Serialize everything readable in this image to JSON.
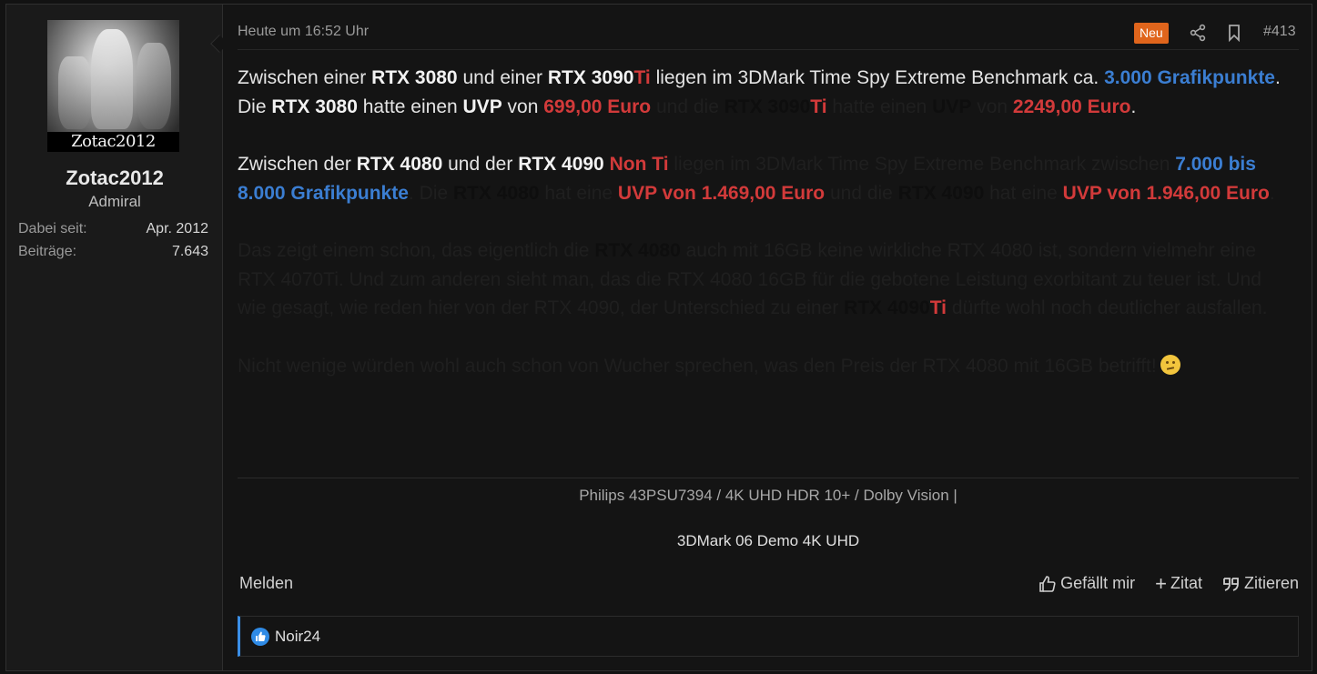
{
  "user": {
    "avatar_caption": "Zotac2012",
    "name": "Zotac2012",
    "title": "Admiral",
    "stats": [
      {
        "key": "Dabei seit:",
        "value": "Apr. 2012"
      },
      {
        "key": "Beiträge:",
        "value": "7.643"
      }
    ]
  },
  "header": {
    "date": "Heute um 16:52 Uhr",
    "new_badge": "Neu",
    "post_number": "#413",
    "share_icon": "share-icon",
    "bookmark_icon": "bookmark-icon"
  },
  "body": {
    "p1": [
      {
        "t": "Zwischen einer ",
        "s": ""
      },
      {
        "t": "RTX 3080",
        "s": "b"
      },
      {
        "t": " und einer ",
        "s": ""
      },
      {
        "t": "RTX 3090",
        "s": "b"
      },
      {
        "t": "Ti",
        "s": "red"
      },
      {
        "t": " liegen im 3DMark Time Spy Extreme Benchmark ca. ",
        "s": ""
      },
      {
        "t": "3.000 Grafikpunkte",
        "s": "blue"
      },
      {
        "t": ". Die ",
        "s": ""
      },
      {
        "t": "RTX 3080",
        "s": "b"
      },
      {
        "t": " hatte einen ",
        "s": ""
      },
      {
        "t": "UVP",
        "s": "b"
      },
      {
        "t": " von ",
        "s": ""
      },
      {
        "t": "699,00 Euro",
        "s": "red"
      },
      {
        "t": " und die ",
        "s": "dim"
      },
      {
        "t": "RTX 3090",
        "s": "dimb"
      },
      {
        "t": "Ti",
        "s": "red"
      },
      {
        "t": " hatte einen ",
        "s": "dim"
      },
      {
        "t": "UVP",
        "s": "dimb"
      },
      {
        "t": " von ",
        "s": "dim"
      },
      {
        "t": "2249,00 Euro",
        "s": "red"
      },
      {
        "t": ".",
        "s": ""
      }
    ],
    "p2": [
      {
        "t": "Zwischen der ",
        "s": ""
      },
      {
        "t": "RTX 4080",
        "s": "b"
      },
      {
        "t": " und der ",
        "s": ""
      },
      {
        "t": "RTX 4090",
        "s": "b"
      },
      {
        "t": " Non Ti",
        "s": "red"
      },
      {
        "t": " liegen im 3DMark Time Spy Extreme Benchmark zwischen ",
        "s": "dim"
      },
      {
        "t": "7.000 bis 8.000 Grafikpunkte",
        "s": "blue"
      },
      {
        "t": ". Die ",
        "s": "dim"
      },
      {
        "t": "RTX 4080",
        "s": "dimb"
      },
      {
        "t": " hat eine ",
        "s": "dim"
      },
      {
        "t": "UVP von 1.469,00 Euro",
        "s": "red"
      },
      {
        "t": " und die ",
        "s": "dim"
      },
      {
        "t": "RTX 4090",
        "s": "dimb"
      },
      {
        "t": " hat eine ",
        "s": "dim"
      },
      {
        "t": "UVP von 1.946,00 Euro",
        "s": "red"
      },
      {
        "t": ".",
        "s": "dim"
      }
    ],
    "p3": [
      {
        "t": "Das zeigt einem schon, das eigentlich die ",
        "s": "dim"
      },
      {
        "t": "RTX 4080",
        "s": "dimb"
      },
      {
        "t": " auch mit 16GB keine wirkliche RTX 4080 ist, sondern vielmehr eine RTX 4070Ti. Und zum anderen sieht man, das die RTX 4080 16GB für die gebotene Leistung exorbitant zu teuer ist. Und wie gesagt, wie reden hier von der RTX 4090, der Unterschied zu einer ",
        "s": "dim"
      },
      {
        "t": "RTX 4090",
        "s": "dimb"
      },
      {
        "t": "Ti",
        "s": "red"
      },
      {
        "t": " dürfte wohl noch deutlicher ausfallen.",
        "s": "dim"
      }
    ],
    "p4": [
      {
        "t": "Nicht wenige würden wohl auch schon von Wucher sprechen, was den Preis der RTX 4080 mit 16GB betrifft!",
        "s": "dim"
      }
    ],
    "emoji": "thinking-emoji"
  },
  "signature": {
    "line1": "Philips 43PSU7394 / 4K UHD HDR 10+ / Dolby Vision |",
    "line2": "3DMark 06 Demo 4K UHD"
  },
  "footer": {
    "report": "Melden",
    "like": "Gefällt mir",
    "quote_plus": "Zitat",
    "quote": "Zitieren"
  },
  "reactions": {
    "icon": "thumbs-up-icon",
    "users": "Noir24"
  },
  "colors": {
    "accent_blue": "#3b7ed2",
    "accent_red": "#d23a3a",
    "badge_orange": "#e0651c"
  }
}
